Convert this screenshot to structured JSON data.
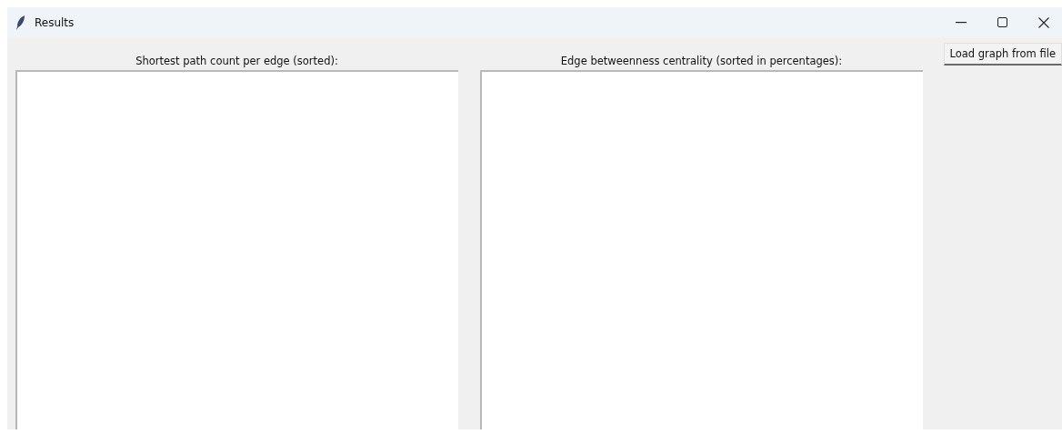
{
  "window": {
    "title": "Results"
  },
  "panels": [
    {
      "label": "Shortest path count per edge (sorted):"
    },
    {
      "label": "Edge betweenness centrality (sorted in percentages):"
    }
  ],
  "buttons": [
    {
      "label": "Load graph from file"
    }
  ]
}
